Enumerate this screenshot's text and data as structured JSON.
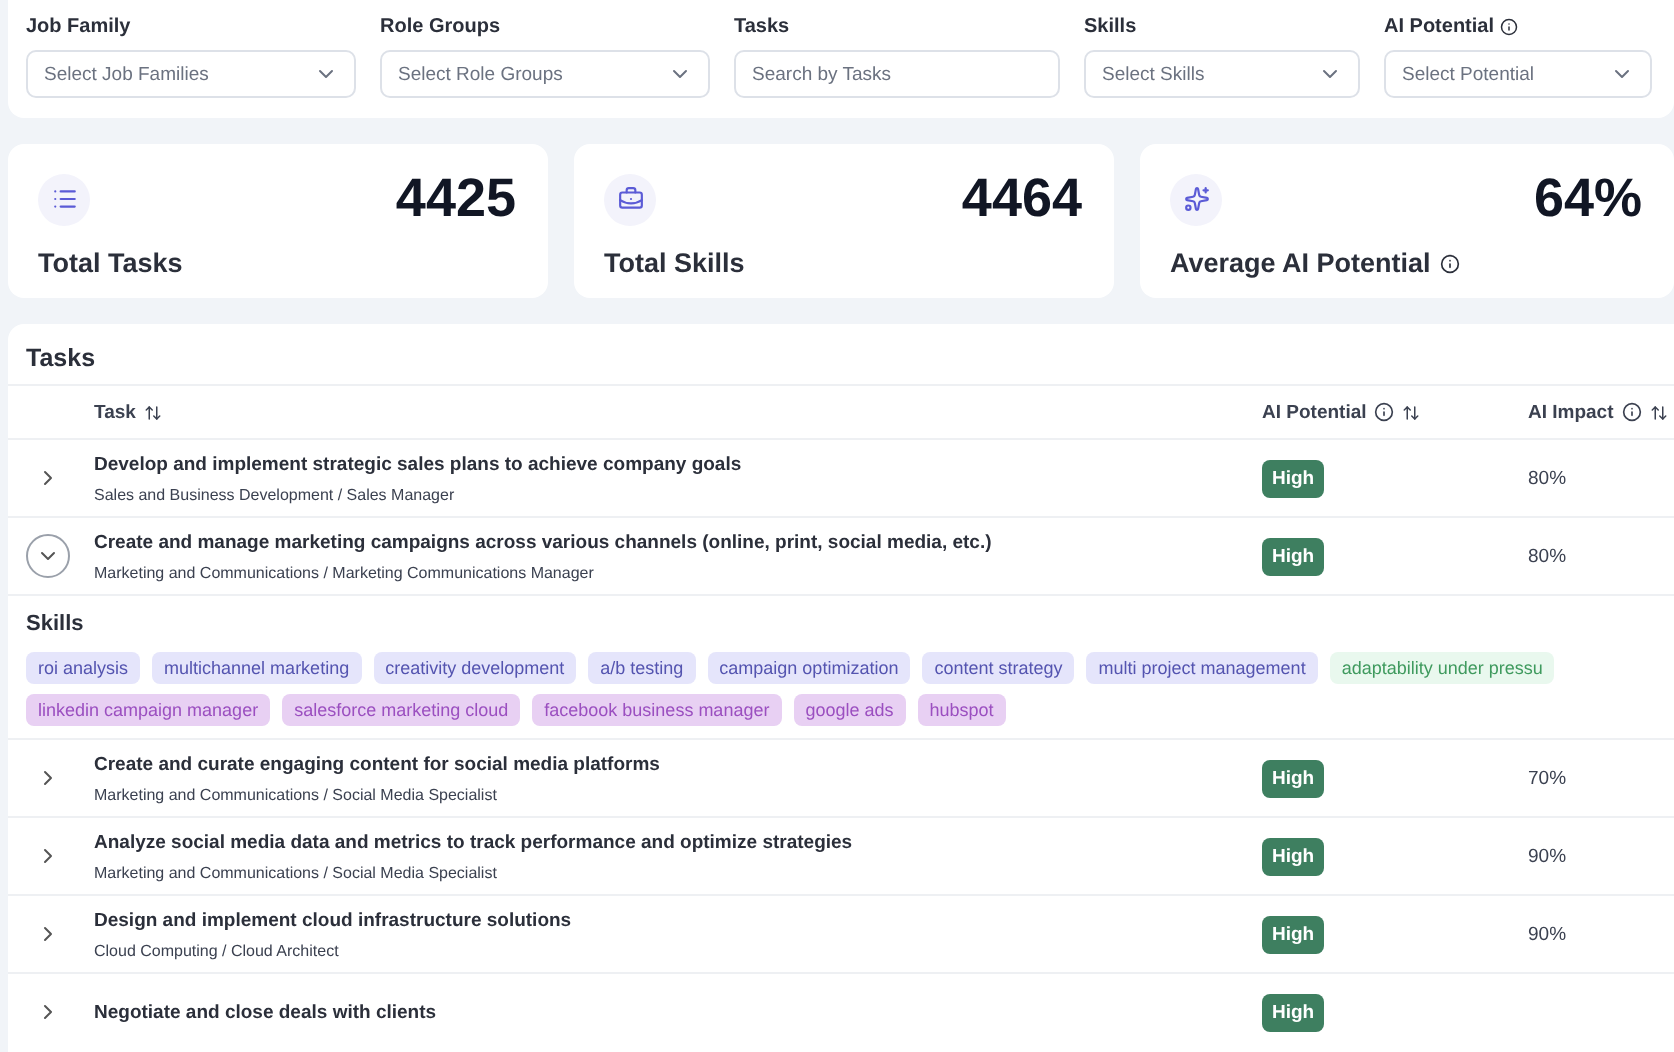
{
  "filters": [
    {
      "label": "Job Family",
      "kind": "select",
      "placeholder": "Select Job Families",
      "info": false
    },
    {
      "label": "Role Groups",
      "kind": "select",
      "placeholder": "Select Role Groups",
      "info": false
    },
    {
      "label": "Tasks",
      "kind": "search",
      "placeholder": "Search by Tasks",
      "info": false
    },
    {
      "label": "Skills",
      "kind": "select",
      "placeholder": "Select Skills",
      "info": false
    },
    {
      "label": "AI Potential",
      "kind": "select",
      "placeholder": "Select Potential",
      "info": true
    }
  ],
  "stats": [
    {
      "kind": "list",
      "value": "4425",
      "label": "Total Tasks",
      "info": false
    },
    {
      "kind": "briefcase",
      "value": "4464",
      "label": "Total Skills",
      "info": false
    },
    {
      "kind": "sparkles",
      "value": "64%",
      "label": "Average AI Potential",
      "info": true
    }
  ],
  "tasks": {
    "title": "Tasks",
    "columns": [
      {
        "label": "Task",
        "info": false
      },
      {
        "label": "AI Potential",
        "info": true
      },
      {
        "label": "AI Impact",
        "info": true
      }
    ],
    "rows": [
      {
        "task": "Develop and implement strategic sales plans to achieve company goals",
        "path": "Sales and Business Development / Sales Manager",
        "potential": "High",
        "impact": "80%",
        "expanded": false
      },
      {
        "task": "Create and manage marketing campaigns across various channels (online, print, social media, etc.)",
        "path": "Marketing and Communications / Marketing Communications Manager",
        "potential": "High",
        "impact": "80%",
        "expanded": true,
        "skills_title": "Skills",
        "skills": [
          {
            "name": "roi analysis",
            "color": "#e5e5fb"
          },
          {
            "name": "multichannel marketing",
            "color": "#e5e5fb"
          },
          {
            "name": "creativity development",
            "color": "#e5e5fb"
          },
          {
            "name": "a/b testing",
            "color": "#e5e5fb"
          },
          {
            "name": "campaign optimization",
            "color": "#e5e5fb"
          },
          {
            "name": "content strategy",
            "color": "#e5e5fb"
          },
          {
            "name": "multi project management",
            "color": "#e5e5fb"
          },
          {
            "name": "adaptability under pressu",
            "color": "#e9f8ee"
          },
          {
            "name": "linkedin campaign manager",
            "color": "#e8d0f3"
          },
          {
            "name": "salesforce marketing cloud",
            "color": "#e8d0f3"
          },
          {
            "name": "facebook business manager",
            "color": "#e8d0f3"
          },
          {
            "name": "google ads",
            "color": "#e8d0f3"
          },
          {
            "name": "hubspot",
            "color": "#e8d0f3"
          }
        ]
      },
      {
        "task": "Create and curate engaging content for social media platforms",
        "path": "Marketing and Communications / Social Media Specialist",
        "potential": "High",
        "impact": "70%",
        "expanded": false
      },
      {
        "task": "Analyze social media data and metrics to track performance and optimize strategies",
        "path": "Marketing and Communications / Social Media Specialist",
        "potential": "High",
        "impact": "90%",
        "expanded": false
      },
      {
        "task": "Design and implement cloud infrastructure solutions",
        "path": "Cloud Computing / Cloud Architect",
        "potential": "High",
        "impact": "90%",
        "expanded": false
      },
      {
        "task": "Negotiate and close deals with clients",
        "path": "",
        "potential": "High",
        "impact": "",
        "expanded": false
      }
    ]
  }
}
